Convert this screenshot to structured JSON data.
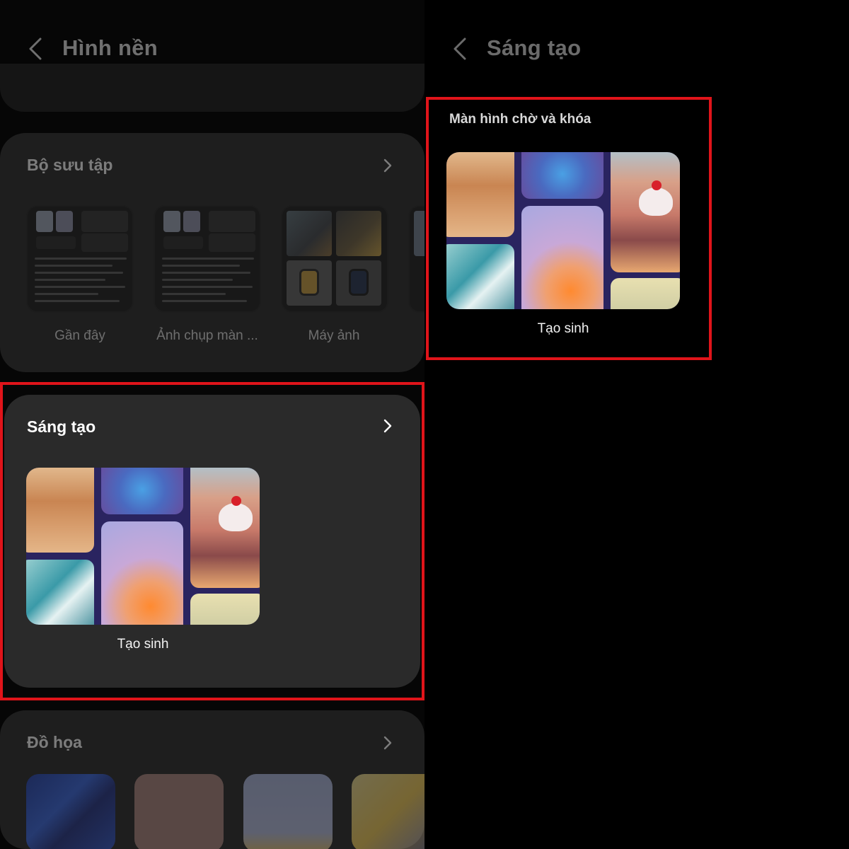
{
  "left_screen": {
    "header": {
      "title": "Hình nền",
      "back_icon": "chevron-left-icon"
    },
    "collections": {
      "title": "Bộ sưu tập",
      "items": [
        {
          "label": "Gần đây"
        },
        {
          "label": "Ảnh chụp màn ..."
        },
        {
          "label": "Máy ảnh"
        }
      ]
    },
    "creative": {
      "title": "Sáng tạo",
      "item_label": "Tạo sinh"
    },
    "graphics": {
      "title": "Đồ họa"
    }
  },
  "right_screen": {
    "header": {
      "title": "Sáng tạo",
      "back_icon": "chevron-left-icon"
    },
    "section": {
      "title": "Màn hình chờ và khóa",
      "item_label": "Tạo sinh"
    }
  },
  "colors": {
    "highlight": "#e0141a",
    "background": "#000000",
    "card": "#2a2a2a",
    "collage_backdrop": "#2a2460"
  }
}
